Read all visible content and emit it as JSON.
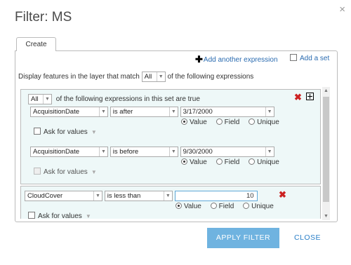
{
  "dialog": {
    "title": "Filter: MS",
    "close_icon": "×"
  },
  "tabs": [
    {
      "label": "Create"
    }
  ],
  "toolbar": {
    "add_expression_label": "Add another expression",
    "add_set_label": "Add a set"
  },
  "match": {
    "prefix": "Display features in the layer that match",
    "value": "All",
    "suffix": "of the following expressions"
  },
  "set": {
    "match_value": "All",
    "match_text": "of the following expressions in this set are true",
    "expressions": [
      {
        "field": "AcquisitionDate",
        "operator": "is after",
        "value": "3/17/2000",
        "radio_value": "Value",
        "radio_field": "Field",
        "radio_unique": "Unique",
        "ask_label": "Ask for values"
      },
      {
        "field": "AcquisitionDate",
        "operator": "is before",
        "value": "9/30/2000",
        "radio_value": "Value",
        "radio_field": "Field",
        "radio_unique": "Unique",
        "ask_label": "Ask for values"
      }
    ]
  },
  "expression": {
    "field": "CloudCover",
    "operator": "is less than",
    "value": "10",
    "radio_value": "Value",
    "radio_field": "Field",
    "radio_unique": "Unique",
    "ask_label": "Ask for values"
  },
  "footer": {
    "apply_label": "APPLY FILTER",
    "close_label": "CLOSE"
  },
  "colors": {
    "accent": "#6fb3e0",
    "link": "#2a6bb0",
    "delete": "#cc2222",
    "set_background": "#eef8f8"
  }
}
